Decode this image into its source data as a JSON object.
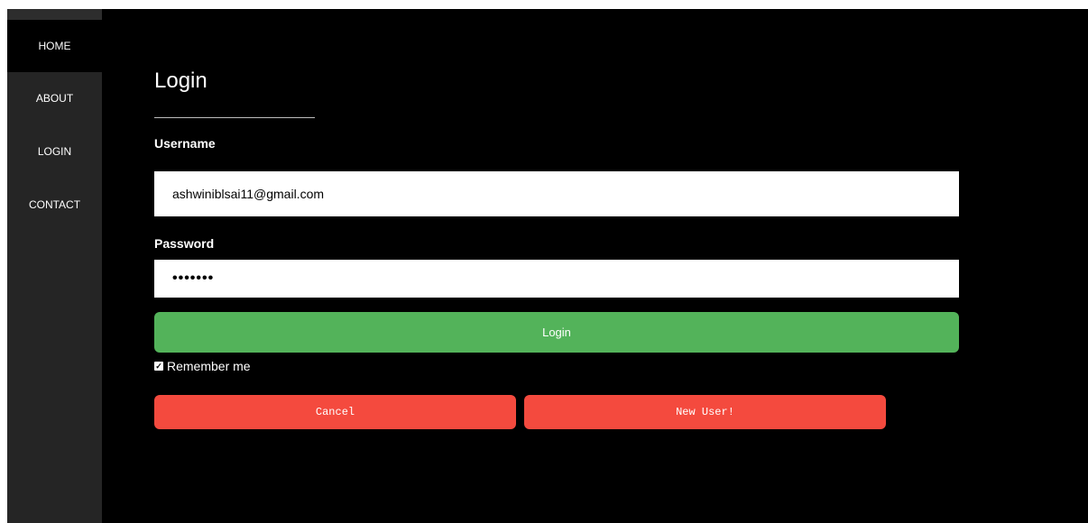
{
  "sidebar": {
    "items": [
      {
        "label": "HOME"
      },
      {
        "label": "ABOUT"
      },
      {
        "label": "LOGIN"
      },
      {
        "label": "CONTACT"
      }
    ]
  },
  "login_form": {
    "title": "Login",
    "username_label": "Username",
    "username_value": "ashwiniblsai11@gmail.com",
    "password_label": "Password",
    "password_masked": "•••••••",
    "login_button_label": "Login",
    "remember_label": "Remember me",
    "remember_checked": true,
    "cancel_button_label": "Cancel",
    "new_user_button_label": "New User!"
  },
  "colors": {
    "background": "#000000",
    "sidebar": "#252525",
    "login_button": "#53b35a",
    "danger_button": "#f44a3e"
  }
}
